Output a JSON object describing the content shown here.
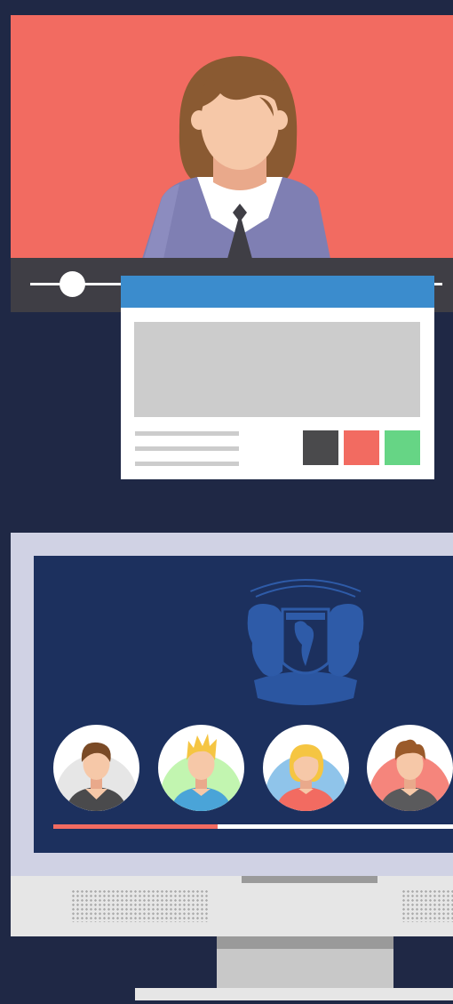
{
  "player": {
    "seek_progress": 0.1,
    "colors": {
      "video_bg": "#f26b61",
      "controls_bg": "#3f3e45"
    }
  },
  "dialog": {
    "colors": {
      "titlebar": "#3b8ccd"
    },
    "buttons": [
      {
        "icon": "dark-square",
        "color": "#4a4a4c"
      },
      {
        "icon": "red-square",
        "color": "#f26b61"
      },
      {
        "icon": "green-square",
        "color": "#66d585"
      }
    ]
  },
  "monitor": {
    "emblem_icon": "unam-seal-icon",
    "participants": [
      {
        "icon": "user-avatar-brown-hair-icon",
        "bg": "#e6e6e6"
      },
      {
        "icon": "user-avatar-blond-spiky-icon",
        "bg": "#c2f5b0"
      },
      {
        "icon": "user-avatar-blonde-woman-icon",
        "bg": "#8fc4ea"
      },
      {
        "icon": "user-avatar-brown-quiff-icon",
        "bg": "#f5857c"
      }
    ],
    "progress": 0.41,
    "colors": {
      "screen_bg": "#1c305e",
      "bezel": "#d0d2e4",
      "progress": "#f26b61"
    }
  }
}
